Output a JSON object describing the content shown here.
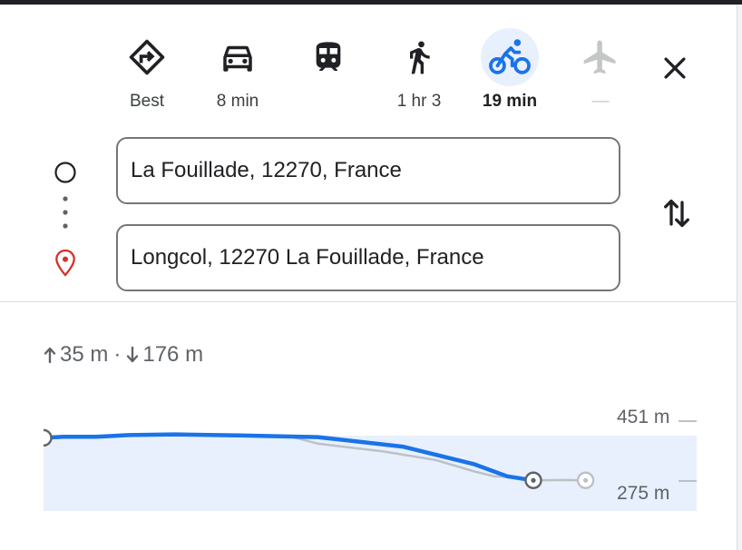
{
  "modes": [
    {
      "id": "best",
      "icon": "diamond-turn-right-icon",
      "label": "Best"
    },
    {
      "id": "driving",
      "icon": "car-icon",
      "label": "8 min"
    },
    {
      "id": "transit",
      "icon": "train-icon",
      "label": ""
    },
    {
      "id": "walking",
      "icon": "walking-icon",
      "label": "1 hr 3"
    },
    {
      "id": "cycling",
      "icon": "bicycle-icon",
      "label": "19 min",
      "active": true
    },
    {
      "id": "flights",
      "icon": "airplane-icon",
      "label": "—",
      "disabled": true
    }
  ],
  "directions": {
    "origin": "La Fouillade, 12270, France",
    "destination": "Longcol, 12270 La Fouillade, France"
  },
  "elevation": {
    "ascent": "35 m",
    "separator": "·",
    "descent": "176 m",
    "max_label": "451 m",
    "min_label": "275 m"
  },
  "colors": {
    "accent": "#1a73e8",
    "active_bg": "#e8f0fe",
    "destination_pin": "#d93025",
    "chart_fill": "#e8f0fe",
    "alt_route": "#bdc1c6"
  },
  "chart_data": {
    "type": "area",
    "title": "",
    "xlabel": "",
    "ylabel": "",
    "ylim": [
      275,
      451
    ],
    "y_tick_labels": [
      "451 m",
      "275 m"
    ],
    "series": [
      {
        "x": [
          0,
          0.03,
          0.08,
          0.13,
          0.2,
          0.3,
          0.42,
          0.55,
          0.66,
          0.71,
          0.75
        ],
        "y": [
          402,
          405,
          405,
          410,
          412,
          409,
          404,
          376,
          324,
          289,
          277
        ]
      },
      {
        "x": [
          0.2,
          0.3,
          0.38,
          0.42,
          0.52,
          0.6,
          0.66,
          0.69,
          0.71,
          0.75,
          0.8,
          0.83
        ],
        "y": [
          412,
          409,
          405,
          385,
          362,
          337,
          303,
          289,
          287,
          277,
          278,
          277
        ]
      }
    ],
    "markers": [
      {
        "x": 0,
        "y": 402
      },
      {
        "x": 0.75,
        "y": 277
      },
      {
        "x": 0.83,
        "y": 277
      }
    ]
  }
}
